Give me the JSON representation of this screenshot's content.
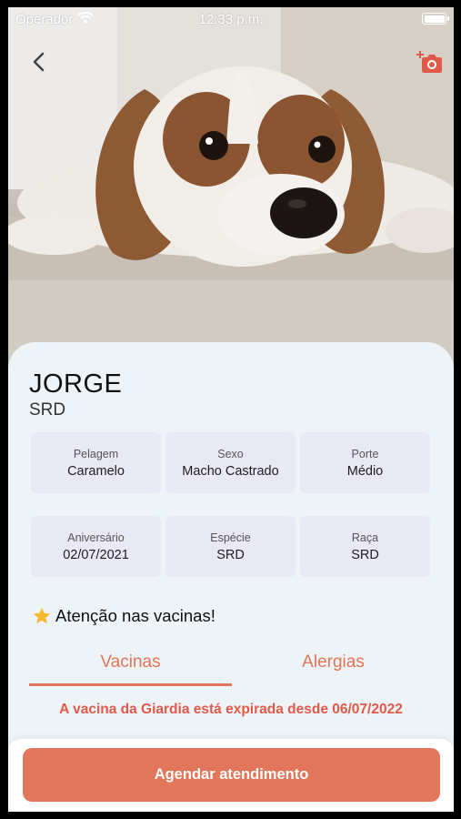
{
  "status_bar": {
    "carrier": "Operador",
    "time": "12:33 p.m."
  },
  "header": {
    "back_icon": "chevron-left-icon",
    "camera_icon": "add-photo-icon"
  },
  "colors": {
    "accent": "#e2765a",
    "warning": "#e05a4a",
    "cell_bg": "#e9e9f6",
    "card_bg": "#eef3f7"
  },
  "pet": {
    "name": "JORGE",
    "breed": "SRD"
  },
  "info": [
    {
      "label": "Pelagem",
      "value": "Caramelo"
    },
    {
      "label": "Sexo",
      "value": "Macho Castrado"
    },
    {
      "label": "Porte",
      "value": "Médio"
    },
    {
      "label": "Aniversário",
      "value": "02/07/2021"
    },
    {
      "label": "Espécie",
      "value": "SRD"
    },
    {
      "label": "Raça",
      "value": "SRD"
    }
  ],
  "alert": {
    "icon": "star-icon",
    "title": "Atenção nas vacinas!"
  },
  "tabs": [
    {
      "label": "Vacinas",
      "active": true
    },
    {
      "label": "Alergias",
      "active": false
    }
  ],
  "warning_message": "A vacina da Giardia está expirada desde 06/07/2022",
  "cta_label": "Agendar atendimento"
}
